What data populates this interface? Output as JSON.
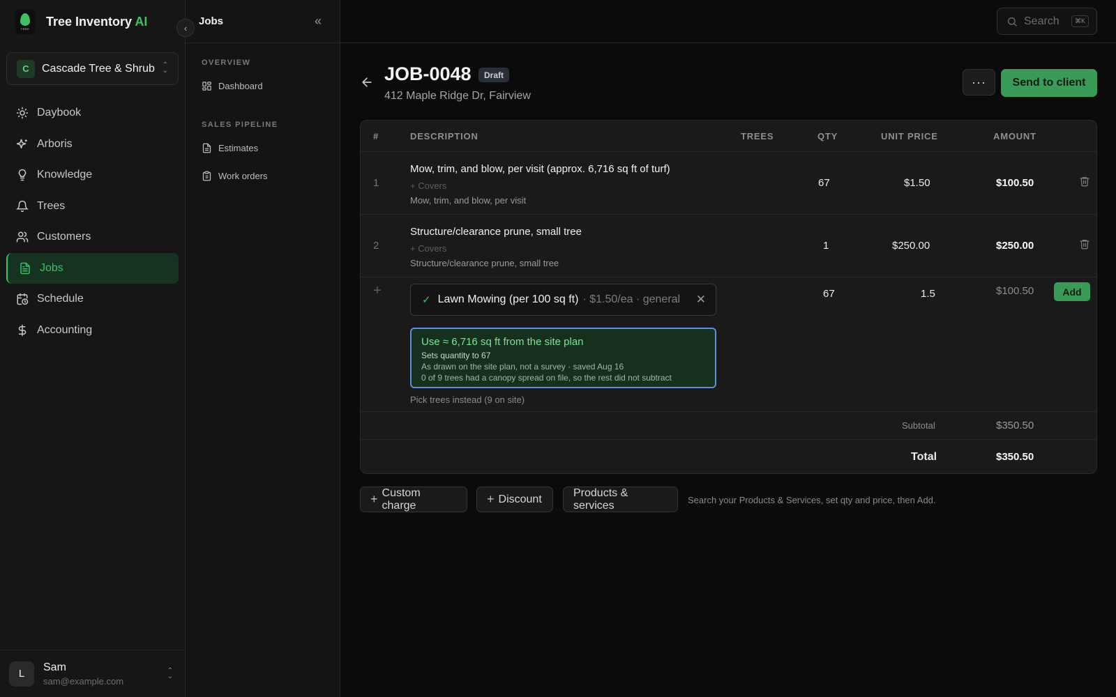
{
  "brand": {
    "name": "Tree Inventory",
    "suffix": "AI",
    "logo_text": "TREE"
  },
  "org": {
    "initial": "C",
    "name": "Cascade Tree & Shrub"
  },
  "nav": [
    {
      "label": "Daybook",
      "icon": "sun-icon"
    },
    {
      "label": "Arboris",
      "icon": "sparkle-icon"
    },
    {
      "label": "Knowledge",
      "icon": "lightbulb-icon"
    },
    {
      "label": "Trees",
      "icon": "bell-icon"
    },
    {
      "label": "Customers",
      "icon": "users-icon"
    },
    {
      "label": "Jobs",
      "icon": "document-icon",
      "active": true
    },
    {
      "label": "Schedule",
      "icon": "calendar-clock-icon"
    },
    {
      "label": "Accounting",
      "icon": "dollar-icon"
    }
  ],
  "user": {
    "initial": "L",
    "name": "Sam",
    "email": "sam@example.com"
  },
  "subpanel": {
    "title": "Jobs",
    "overview_label": "OVERVIEW",
    "dashboard": "Dashboard",
    "pipeline_label": "SALES PIPELINE",
    "estimates": "Estimates",
    "work_orders": "Work orders"
  },
  "search": {
    "placeholder": "Search",
    "shortcut": "⌘K"
  },
  "job": {
    "id": "JOB-0048",
    "status": "Draft",
    "address": "412 Maple Ridge Dr, Fairview",
    "more_label": "···",
    "send_label": "Send to client"
  },
  "table": {
    "headers": {
      "num": "#",
      "description": "DESCRIPTION",
      "trees": "TREES",
      "qty": "QTY",
      "unit_price": "UNIT PRICE",
      "amount": "AMOUNT"
    },
    "rows": [
      {
        "num": "1",
        "title": "Mow, trim, and blow, per visit (approx. 6,716 sq ft of turf)",
        "covers": "+ Covers",
        "subtitle": "Mow, trim, and blow, per visit",
        "qty": "67",
        "unit_price": "$1.50",
        "amount": "$100.50"
      },
      {
        "num": "2",
        "title": "Structure/clearance prune, small tree",
        "covers": "+ Covers",
        "subtitle": "Structure/clearance prune, small tree",
        "qty": "1",
        "unit_price": "$250.00",
        "amount": "$250.00"
      }
    ],
    "new_line": {
      "plus": "+",
      "product_name": "Lawn Mowing (per 100 sq ft)",
      "product_meta": "· $1.50/ea · general",
      "qty": "67",
      "unit_price": "1.5",
      "amount": "$100.50",
      "add_label": "Add",
      "suggestion": {
        "title": "Use ≈ 6,716 sq ft from the site plan",
        "line1": "Sets quantity to 67",
        "line2": "As drawn on the site plan, not a survey · saved Aug 16",
        "line3": "0 of 9 trees had a canopy spread on file, so the rest did not subtract"
      },
      "pick_trees": "Pick trees instead (9 on site)"
    },
    "subtotal_label": "Subtotal",
    "subtotal": "$350.50",
    "total_label": "Total",
    "total": "$350.50"
  },
  "actions": {
    "custom_charge": "Custom charge",
    "discount": "Discount",
    "products_services": "Products & services",
    "hint": "Search your Products & Services, set qty and price, then Add."
  },
  "colors": {
    "accent": "#3fbf66",
    "button_green": "#3a9b58",
    "focus_blue": "#5e8ee0"
  }
}
